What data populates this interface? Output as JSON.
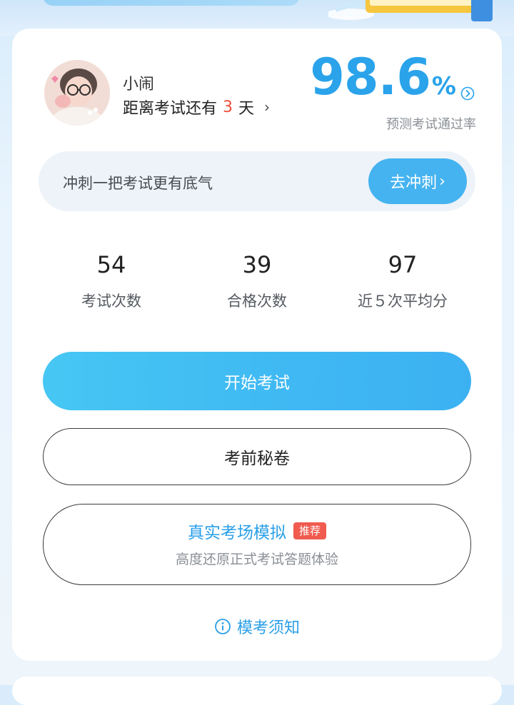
{
  "profile": {
    "name": "小闹",
    "countdown_prefix": "距离考试还有",
    "countdown_days": "3",
    "countdown_suffix": "天",
    "chevron": "›"
  },
  "prediction": {
    "value": "98.6",
    "unit": "%",
    "label": "预测考试通过率",
    "arrow_icon": "circle-chevron-right-icon"
  },
  "sprint": {
    "text": "冲刺一把考试更有底气",
    "button_label": "去冲刺",
    "button_chevron": "›"
  },
  "stats": [
    {
      "value": "54",
      "label": "考试次数"
    },
    {
      "value": "39",
      "label": "合格次数"
    },
    {
      "value": "97",
      "label": "近５次平均分"
    }
  ],
  "actions": {
    "start_label": "开始考试",
    "secret_label": "考前秘卷",
    "simulation_title": "真实考场模拟",
    "simulation_badge": "推荐",
    "simulation_subtitle": "高度还原正式考试答题体验"
  },
  "notice": {
    "label": "模考须知",
    "icon": "info-circle-icon"
  },
  "colors": {
    "accent": "#2aa3ea",
    "button_blue": "#45b3f0",
    "highlight_red": "#f0503c",
    "badge_red": "#f05a4f"
  }
}
